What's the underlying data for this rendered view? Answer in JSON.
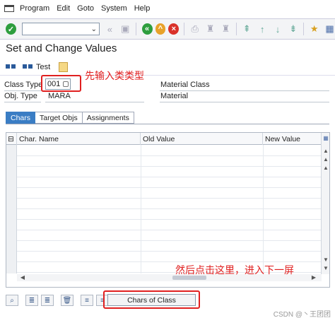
{
  "menu": {
    "items": [
      "Program",
      "Edit",
      "Goto",
      "System",
      "Help"
    ]
  },
  "toolbar": {
    "command_field_value": "",
    "chevron": "⌄",
    "enter_icon": "check-icon",
    "back_icon": "back-icon",
    "exit_icon": "exit-icon",
    "cancel_icon": "cancel-icon",
    "colors": {
      "green": "#2e9e3e",
      "orange": "#e8a22a",
      "red": "#d9322a"
    }
  },
  "screen": {
    "title": "Set and Change Values"
  },
  "app_toolbar": {
    "test_label": "Test"
  },
  "header": {
    "class_type_label": "Class Type",
    "class_type_value": "001",
    "class_name_value": "Material Class",
    "obj_type_label": "Obj. Type",
    "obj_type_value": "MARA",
    "obj_type_desc": "Material"
  },
  "annotations": {
    "first": "先输入类类型",
    "second": "然后点击这里，进入下一屏",
    "accent_color": "#e02020"
  },
  "tabs": [
    {
      "label": "Chars",
      "active": true
    },
    {
      "label": "Target Objs",
      "active": false
    },
    {
      "label": "Assignments",
      "active": false
    }
  ],
  "grid": {
    "columns": [
      "Char. Name",
      "Old Value",
      "New Value"
    ],
    "rows": []
  },
  "footer": {
    "chars_of_class_button": "Chars of Class",
    "watermark": "CSDN @丶王团团"
  }
}
